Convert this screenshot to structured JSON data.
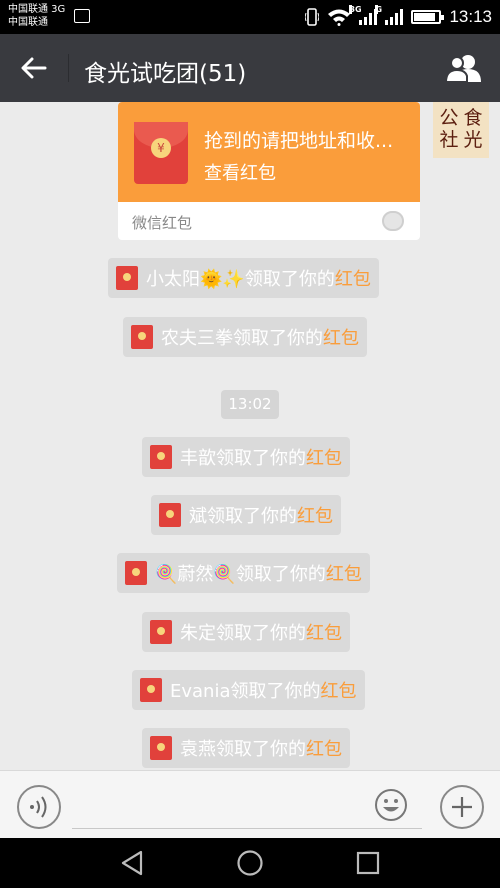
{
  "status_bar": {
    "carrier_line1": "中国联通 3G",
    "carrier_line2": "中国联通",
    "signal1_label": "3G",
    "signal2_label": "G",
    "battery_level": 0.8,
    "time": "13:13"
  },
  "header": {
    "title": "食光试吃团(51)"
  },
  "red_packet_card": {
    "text": "抢到的请把地址和收...",
    "action": "查看红包",
    "label": "微信红包",
    "coin_symbol": "¥"
  },
  "avatar": {
    "chars": [
      "公",
      "食",
      "社",
      "光"
    ]
  },
  "notices": [
    {
      "name": "小太阳🌞✨",
      "suffix": "领取了你的",
      "highlight": "红包"
    },
    {
      "name": "农夫三拳",
      "suffix": "领取了你的",
      "highlight": "红包"
    },
    {
      "name": "丰歆",
      "suffix": "领取了你的",
      "highlight": "红包"
    },
    {
      "name": "斌",
      "suffix": "领取了你的",
      "highlight": "红包"
    },
    {
      "name": "🍭蔚然🍭",
      "suffix": "领取了你的",
      "highlight": "红包"
    },
    {
      "name": "朱定",
      "suffix": "领取了你的",
      "highlight": "红包"
    },
    {
      "name": "Evania",
      "suffix": "领取了你的",
      "highlight": "红包"
    },
    {
      "name": "袁燕",
      "suffix": "领取了你的",
      "highlight": "红包"
    }
  ],
  "time_divider": "13:02",
  "input": {
    "value": "",
    "placeholder": ""
  },
  "colors": {
    "red_packet_orange": "#fa9d3b",
    "envelope_red": "#e1413b",
    "topbar": "#393a3f"
  }
}
